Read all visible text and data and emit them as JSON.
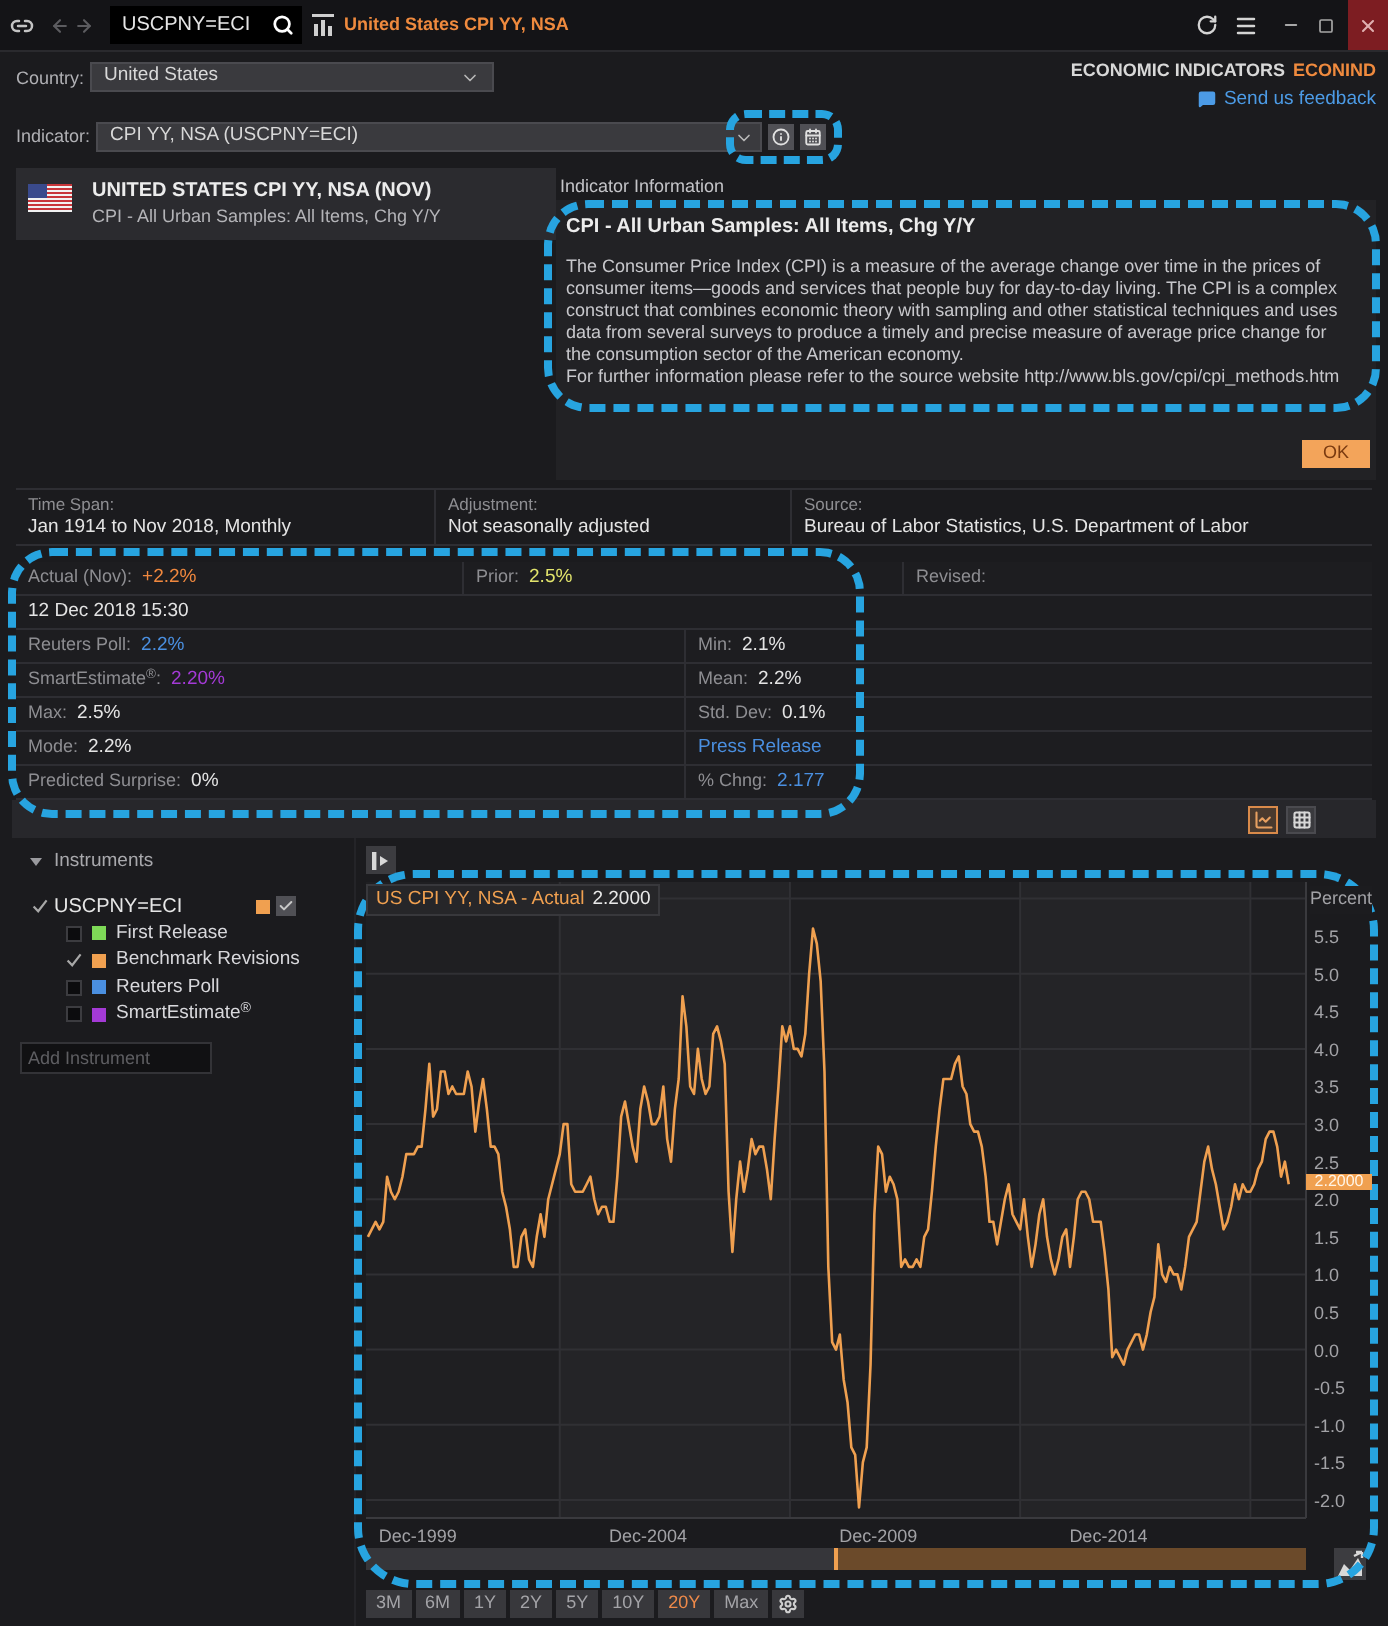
{
  "title_bar": {
    "search_value": "USCPNY=ECI",
    "title": "United States CPI YY, NSA"
  },
  "app": {
    "name": "ECONOMIC INDICATORS",
    "code": "ECONIND",
    "feedback": "Send us feedback"
  },
  "country": {
    "label": "Country:",
    "value": "United States"
  },
  "indicator": {
    "label": "Indicator:",
    "value": "CPI YY, NSA (USCPNY=ECI)",
    "tools_highlighted": true
  },
  "header": {
    "title": "UNITED STATES CPI YY, NSA (NOV)",
    "subtitle": "CPI - All Urban Samples: All Items, Chg Y/Y"
  },
  "info_panel": {
    "label": "Indicator Information",
    "title": "CPI - All Urban Samples: All Items, Chg Y/Y",
    "paragraphs": [
      "The Consumer Price Index (CPI) is a measure of the average change over time in the prices of consumer items—goods and services that people buy for day-to-day living. The CPI is a complex construct that combines economic theory with sampling and other statistical techniques and uses data from several surveys to produce a timely and precise measure of average price change for the consumption sector of the American economy.",
      "For further information please refer to the source website http://www.bls.gov/cpi/cpi_methods.htm"
    ],
    "button": "OK",
    "highlighted": true
  },
  "details": [
    {
      "label": "Time Span:",
      "value": "Jan 1914 to Nov 2018, Monthly"
    },
    {
      "label": "Adjustment:",
      "value": "Not seasonally adjusted"
    },
    {
      "label": "Source:",
      "value": "Bureau of Labor Statistics, U.S. Department of Labor"
    }
  ],
  "stats": {
    "highlighted": true,
    "rows": [
      {
        "cells": [
          {
            "kind": "stat",
            "label": "Actual (Nov):",
            "value": "+2.2%",
            "color": "#f0883e"
          },
          {
            "kind": "stat",
            "label": "Prior:",
            "value": "2.5%",
            "color": "#e2e46c"
          },
          {
            "kind": "stat",
            "label": "Revised:"
          }
        ]
      },
      {
        "cells": [
          {
            "kind": "text",
            "value": "12 Dec 2018 15:30"
          }
        ]
      },
      {
        "cells": [
          {
            "kind": "stat",
            "label": "Reuters Poll:",
            "value": "2.2%",
            "color": "#4a8fe0"
          },
          {
            "kind": "stat",
            "label": "Min:",
            "value": "2.1%"
          }
        ]
      },
      {
        "cells": [
          {
            "kind": "stat",
            "label": "SmartEstimate$^{®}$:",
            "value": "2.20%",
            "color": "#a43ad6"
          },
          {
            "kind": "stat",
            "label": "Mean:",
            "value": "2.2%"
          }
        ]
      },
      {
        "cells": [
          {
            "kind": "stat",
            "label": "Max:",
            "value": "2.5%"
          },
          {
            "kind": "stat",
            "label": "Std. Dev:",
            "value": "0.1%"
          }
        ]
      },
      {
        "cells": [
          {
            "kind": "stat",
            "label": "Mode:",
            "value": "2.2%"
          },
          {
            "kind": "link",
            "value": "Press Release"
          }
        ]
      },
      {
        "cells": [
          {
            "kind": "stat",
            "label": "Predicted Surprise:",
            "value": "0%"
          },
          {
            "kind": "stat",
            "label": "% Chng:",
            "value": "2.177",
            "color": "#4a8fe0"
          }
        ]
      }
    ]
  },
  "view_toggle": [
    {
      "kind": "chart",
      "selected": true
    },
    {
      "kind": "table",
      "selected": false
    }
  ],
  "instruments": {
    "title": "Instruments",
    "expanded": true,
    "items": [
      {
        "label": "USCPNY=ECI",
        "checked": true,
        "color": "#f0a050",
        "children": [
          {
            "label": "First Release",
            "checked": false,
            "color": "#7ed957"
          },
          {
            "label": "Benchmark Revisions",
            "checked": true,
            "color": "#f0a050"
          },
          {
            "label": "Reuters Poll",
            "checked": false,
            "color": "#4a8fe0"
          },
          {
            "label": "SmartEstimate$^{®}$",
            "checked": false,
            "color": "#a43ad6"
          }
        ]
      }
    ],
    "add_placeholder": "Add Instrument"
  },
  "chart": {
    "highlighted": true,
    "legend_value": "2.2000",
    "last_value": "2.2000",
    "chart_data": {
      "type": "line",
      "ylabel": "Percent",
      "ylim": [
        -2.24,
        6.22
      ],
      "grid": true,
      "categories": [
        null,
        null,
        null,
        null,
        null,
        null,
        null,
        null,
        null,
        null,
        null,
        null,
        null,
        "Dec-1999",
        null,
        null,
        null,
        null,
        null,
        null,
        null,
        null,
        null,
        null,
        null,
        null,
        null,
        null,
        null,
        null,
        null,
        null,
        null,
        null,
        null,
        null,
        null,
        null,
        null,
        null,
        null,
        null,
        null,
        null,
        null,
        null,
        null,
        null,
        null,
        null,
        null,
        null,
        null,
        null,
        null,
        null,
        null,
        null,
        null,
        null,
        null,
        null,
        null,
        null,
        null,
        null,
        null,
        null,
        null,
        null,
        null,
        null,
        null,
        "Dec-2004",
        null,
        null,
        null,
        null,
        null,
        null,
        null,
        null,
        null,
        null,
        null,
        null,
        null,
        null,
        null,
        null,
        null,
        null,
        null,
        null,
        null,
        null,
        null,
        null,
        null,
        null,
        null,
        null,
        null,
        null,
        null,
        null,
        null,
        null,
        null,
        null,
        null,
        null,
        null,
        null,
        null,
        null,
        null,
        null,
        null,
        null,
        null,
        null,
        null,
        null,
        null,
        null,
        null,
        null,
        null,
        null,
        null,
        null,
        null,
        "Dec-2009",
        null,
        null,
        null,
        null,
        null,
        null,
        null,
        null,
        null,
        null,
        null,
        null,
        null,
        null,
        null,
        null,
        null,
        null,
        null,
        null,
        null,
        null,
        null,
        null,
        null,
        null,
        null,
        null,
        null,
        null,
        null,
        null,
        null,
        null,
        null,
        null,
        null,
        null,
        null,
        null,
        null,
        null,
        null,
        null,
        null,
        null,
        null,
        null,
        null,
        null,
        null,
        null,
        null,
        null,
        null,
        null,
        null,
        null,
        null,
        "Dec-2014",
        null,
        null,
        null,
        null,
        null,
        null,
        null,
        null,
        null,
        null,
        null,
        null,
        null,
        null,
        null,
        null,
        null,
        null,
        null,
        null,
        null,
        null,
        null,
        null,
        null,
        null,
        null,
        null,
        null,
        null,
        null,
        null,
        null,
        null,
        null,
        null,
        null,
        null,
        null,
        null,
        null,
        null,
        null,
        null,
        null,
        null,
        null
      ],
      "series": [
        {
          "name": "US CPI YY, NSA - Actual",
          "color": "#f0a050",
          "values": [
            1.5,
            1.6,
            1.7,
            1.6,
            1.7,
            2.3,
            2.1,
            2.0,
            2.1,
            2.3,
            2.6,
            2.6,
            2.6,
            2.7,
            2.7,
            3.2,
            3.8,
            3.1,
            3.2,
            3.7,
            3.7,
            3.4,
            3.5,
            3.4,
            3.4,
            3.4,
            3.7,
            3.5,
            2.9,
            3.3,
            3.6,
            3.2,
            2.7,
            2.7,
            2.6,
            2.1,
            1.9,
            1.6,
            1.1,
            1.1,
            1.5,
            1.6,
            1.2,
            1.1,
            1.5,
            1.8,
            1.5,
            2.0,
            2.2,
            2.4,
            2.6,
            3.0,
            3.0,
            2.2,
            2.1,
            2.1,
            2.1,
            2.2,
            2.3,
            2.0,
            1.8,
            1.9,
            1.9,
            1.7,
            1.7,
            2.3,
            3.1,
            3.3,
            3.0,
            2.7,
            2.5,
            3.2,
            3.5,
            3.3,
            3.0,
            3.0,
            3.1,
            3.5,
            2.8,
            2.5,
            3.2,
            3.6,
            4.7,
            4.3,
            3.5,
            3.4,
            4.0,
            3.6,
            3.4,
            3.5,
            4.2,
            4.3,
            4.1,
            3.8,
            2.1,
            1.3,
            2.0,
            2.5,
            2.1,
            2.4,
            2.8,
            2.6,
            2.7,
            2.7,
            2.4,
            2.0,
            2.8,
            3.5,
            4.3,
            4.1,
            4.3,
            4.0,
            4.0,
            3.9,
            4.2,
            5.0,
            5.6,
            5.4,
            4.9,
            3.7,
            1.1,
            0.1,
            0.0,
            0.2,
            -0.4,
            -0.7,
            -1.3,
            -1.4,
            -2.1,
            -1.5,
            -1.3,
            -0.2,
            1.8,
            2.7,
            2.6,
            2.1,
            2.3,
            2.2,
            2.0,
            1.1,
            1.2,
            1.1,
            1.1,
            1.2,
            1.1,
            1.5,
            1.6,
            2.1,
            2.7,
            3.2,
            3.6,
            3.6,
            3.6,
            3.8,
            3.9,
            3.5,
            3.4,
            3.0,
            2.9,
            2.9,
            2.7,
            2.3,
            1.7,
            1.7,
            1.4,
            1.7,
            2.0,
            2.2,
            1.8,
            1.7,
            1.6,
            2.0,
            1.5,
            1.1,
            1.4,
            1.8,
            2.0,
            1.5,
            1.2,
            1.0,
            1.2,
            1.5,
            1.6,
            1.1,
            1.5,
            2.0,
            2.1,
            2.1,
            2.0,
            1.7,
            1.7,
            1.7,
            1.3,
            0.8,
            -0.1,
            0.0,
            -0.1,
            -0.2,
            0.0,
            0.1,
            0.2,
            0.2,
            0.0,
            0.2,
            0.5,
            0.7,
            1.4,
            1.0,
            0.9,
            1.1,
            1.0,
            1.0,
            0.8,
            1.1,
            1.5,
            1.6,
            1.7,
            2.1,
            2.5,
            2.7,
            2.4,
            2.2,
            1.9,
            1.6,
            1.7,
            1.9,
            2.2,
            2.0,
            2.2,
            2.1,
            2.1,
            2.2,
            2.4,
            2.5,
            2.8,
            2.9,
            2.9,
            2.7,
            2.3,
            2.5,
            2.2
          ]
        }
      ],
      "yticks": [
        {
          "value": -2,
          "label": "-2.0"
        },
        {
          "value": -1.5,
          "label": "-1.5"
        },
        {
          "value": -1,
          "label": "-1.0"
        },
        {
          "value": -0.5,
          "label": "-0.5"
        },
        {
          "value": 0,
          "label": "0.0"
        },
        {
          "value": 0.5,
          "label": "0.5"
        },
        {
          "value": 1,
          "label": "1.0"
        },
        {
          "value": 1.5,
          "label": "1.5"
        },
        {
          "value": 2,
          "label": "2.0"
        },
        {
          "value": 2.5,
          "label": "2.5"
        },
        {
          "value": 3,
          "label": "3.0"
        },
        {
          "value": 3.5,
          "label": "3.5"
        },
        {
          "value": 4,
          "label": "4.0"
        },
        {
          "value": 4.5,
          "label": "4.5"
        },
        {
          "value": 5,
          "label": "5.0"
        },
        {
          "value": 5.5,
          "label": "5.5"
        }
      ]
    },
    "ranges": [
      {
        "label": "3M",
        "selected": false
      },
      {
        "label": "6M",
        "selected": false
      },
      {
        "label": "1Y",
        "selected": false
      },
      {
        "label": "2Y",
        "selected": false
      },
      {
        "label": "5Y",
        "selected": false
      },
      {
        "label": "10Y",
        "selected": false
      },
      {
        "label": "20Y",
        "selected": true
      },
      {
        "label": "Max",
        "selected": false
      }
    ]
  }
}
